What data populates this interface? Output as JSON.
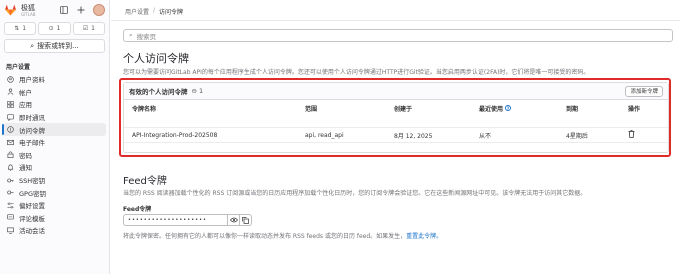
{
  "app": {
    "brand": "极狐",
    "brand_sub": "GITLAB"
  },
  "sidebar": {
    "counts": [
      {
        "icon": "merge-request-icon",
        "value": "1"
      },
      {
        "icon": "issues-icon",
        "value": "1"
      },
      {
        "icon": "todo-icon",
        "value": "1"
      }
    ],
    "search_label": "搜索或转到...",
    "section_title": "用户设置",
    "items": [
      {
        "label": "用户资料",
        "icon": "user-icon",
        "active": false
      },
      {
        "label": "帐户",
        "icon": "account-icon",
        "active": false
      },
      {
        "label": "应用",
        "icon": "applications-icon",
        "active": false
      },
      {
        "label": "即时通讯",
        "icon": "chat-icon",
        "active": false
      },
      {
        "label": "访问令牌",
        "icon": "token-icon",
        "active": true
      },
      {
        "label": "电子邮件",
        "icon": "email-icon",
        "active": false
      },
      {
        "label": "密码",
        "icon": "lock-icon",
        "active": false
      },
      {
        "label": "通知",
        "icon": "notifications-icon",
        "active": false
      },
      {
        "label": "SSH密钥",
        "icon": "key-icon",
        "active": false
      },
      {
        "label": "GPG密钥",
        "icon": "gpg-key-icon",
        "active": false
      },
      {
        "label": "偏好设置",
        "icon": "preferences-icon",
        "active": false
      },
      {
        "label": "评论模板",
        "icon": "comment-template-icon",
        "active": false
      },
      {
        "label": "活动会话",
        "icon": "sessions-icon",
        "active": false
      }
    ]
  },
  "breadcrumb": {
    "parent": "用户设置",
    "current": "访问令牌"
  },
  "search": {
    "placeholder": "搜索页"
  },
  "pat": {
    "title": "个人访问令牌",
    "description": "您可以为需要访问GitLab API的每个应用程序生成个人访问令牌。您还可以使用个人访问令牌通过HTTP进行Git验证。当您启用两步认证(2FA)时，它们将是唯一可接受的密码。",
    "card_title": "有效的个人访问令牌",
    "count": "1",
    "add_button": "添加新令牌",
    "columns": [
      "令牌名称",
      "范围",
      "创建于",
      "最近使用",
      "到期",
      "操作"
    ],
    "rows": [
      {
        "name": "API-Integration-Prod-202508",
        "scopes": "api, read_api",
        "created": "8月 12, 2025",
        "last_used": "从不",
        "expires": "4星期后"
      }
    ]
  },
  "feed": {
    "title": "Feed令牌",
    "description": "当您的 RSS 阅读器加载个性化的 RSS 订阅源或当您的日历应用程序加载个性化日历时，您的订阅令牌会验证您。它在这些新闻源网址中可见。该令牌无法用于访问其它数据。",
    "label": "Feed令牌",
    "masked_value": "••••••••••••••••••••",
    "help_text": "将此令牌保密。任何拥有它的人都可以像你一样读取动态并发布 RSS feeds 或您的日历 feed。如果发生，",
    "reset_link": "重置此令牌。"
  },
  "colors": {
    "accent": "#1f75cb",
    "highlight_border": "#e02b2b",
    "logo": "#e24329"
  }
}
